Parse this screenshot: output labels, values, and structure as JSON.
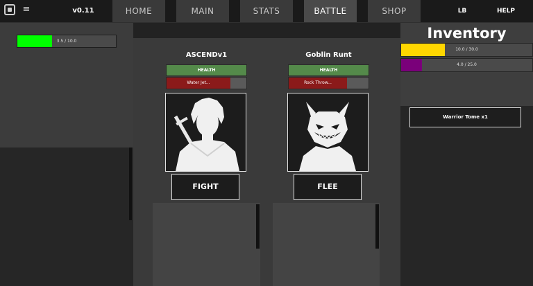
{
  "topbar": {
    "version": "v0.11",
    "tabs": [
      {
        "label": "HOME",
        "active": false
      },
      {
        "label": "MAIN",
        "active": false
      },
      {
        "label": "STATS",
        "active": false
      },
      {
        "label": "BATTLE",
        "active": true
      },
      {
        "label": "SHOP",
        "active": false
      }
    ],
    "lb_label": "LB",
    "help_label": "HELP",
    "menu_glyph": "≡"
  },
  "player_xp": {
    "text": "3.5 / 10.0",
    "fraction": 0.35,
    "color": "#00ff00"
  },
  "battle": {
    "player": {
      "name": "ASCENDv1",
      "health_label": "HEALTH",
      "action_label": "Water Jet...",
      "action_fraction": 0.8,
      "portrait_icon": "swordsman-silhouette-icon"
    },
    "enemy": {
      "name": "Goblin Runt",
      "health_label": "HEALTH",
      "action_label": "Rock Throw...",
      "action_fraction": 0.73,
      "portrait_icon": "goblin-silhouette-icon"
    },
    "fight_label": "FIGHT",
    "flee_label": "FLEE"
  },
  "inventory": {
    "title": "Inventory",
    "bars": [
      {
        "text": "10.0 / 30.0",
        "fraction": 0.333,
        "color": "#ffd700"
      },
      {
        "text": "4.0 / 25.0",
        "fraction": 0.16,
        "color": "#7a007a"
      }
    ],
    "items": [
      "Warrior Tome x1"
    ]
  },
  "colors": {
    "health": "#548a4a",
    "action": "#8b1a1a"
  }
}
